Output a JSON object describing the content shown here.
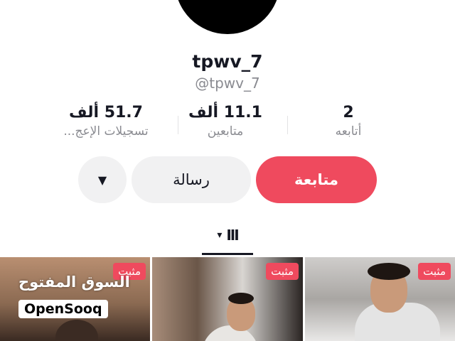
{
  "profile": {
    "username": "tpwv_7",
    "handle": "@tpwv_7"
  },
  "stats": [
    {
      "value": "2",
      "label": "أتابعه"
    },
    {
      "value": "11.1 ألف",
      "label": "متابعين"
    },
    {
      "value": "51.7 ألف",
      "label": "تسجيلات الإعج..."
    }
  ],
  "actions": {
    "follow_label": "متابعة",
    "message_label": "رسالة",
    "more_glyph": "▼"
  },
  "tabs": {
    "grid_glyph": "III",
    "caret_glyph": "▾"
  },
  "videos": [
    {
      "badge": "مثبت"
    },
    {
      "badge": "مثبت"
    },
    {
      "badge": "مثبت"
    }
  ],
  "watermark": {
    "arabic": "السوق المفتوح",
    "latin": "OpenSooq"
  },
  "colors": {
    "accent": "#ef4a5e",
    "text": "#161823",
    "muted": "#8a8b91",
    "button_bg": "#f1f1f2"
  }
}
